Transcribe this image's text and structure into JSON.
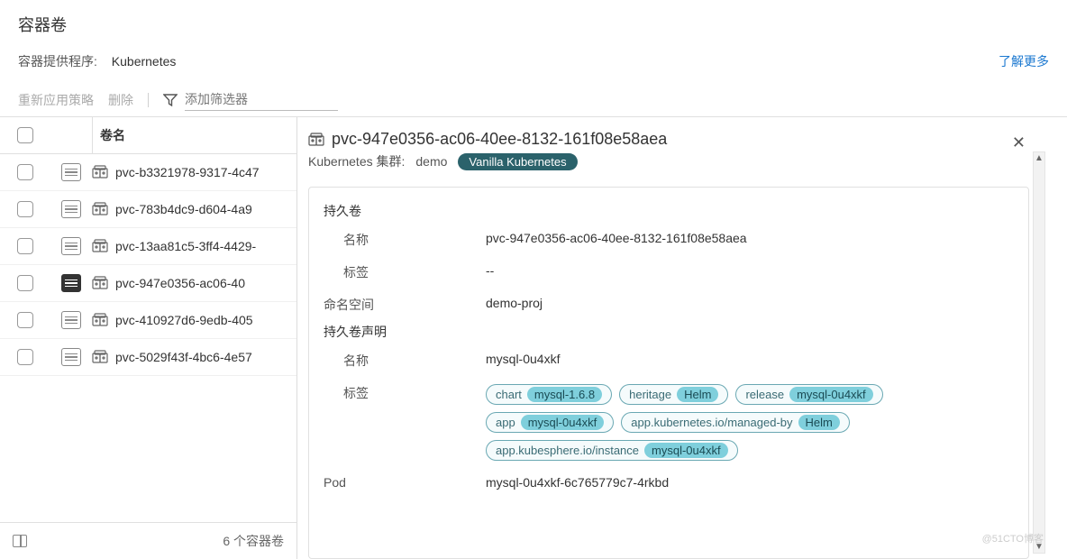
{
  "page_title": "容器卷",
  "provider_label": "容器提供程序:",
  "provider_value": "Kubernetes",
  "learn_more": "了解更多",
  "toolbar": {
    "reapply_policy": "重新应用策略",
    "delete": "删除",
    "filter_placeholder": "添加筛选器"
  },
  "table": {
    "header_name": "卷名",
    "rows": [
      {
        "name": "pvc-b3321978-9317-4c47",
        "selected": false
      },
      {
        "name": "pvc-783b4dc9-d604-4a9",
        "selected": false
      },
      {
        "name": "pvc-13aa81c5-3ff4-4429-",
        "selected": false
      },
      {
        "name": "pvc-947e0356-ac06-40",
        "selected": true
      },
      {
        "name": "pvc-410927d6-9edb-405",
        "selected": false
      },
      {
        "name": "pvc-5029f43f-4bc6-4e57",
        "selected": false
      }
    ],
    "footer_count": "6 个容器卷"
  },
  "detail": {
    "title": "pvc-947e0356-ac06-40ee-8132-161f08e58aea",
    "cluster_label": "Kubernetes 集群:",
    "cluster_value": "demo",
    "cluster_badge": "Vanilla Kubernetes",
    "sections": {
      "pv": {
        "title": "持久卷",
        "name_label": "名称",
        "name_value": "pvc-947e0356-ac06-40ee-8132-161f08e58aea",
        "tag_label": "标签",
        "tag_value": "--"
      },
      "namespace": {
        "label": "命名空间",
        "value": "demo-proj"
      },
      "pvc": {
        "title": "持久卷声明",
        "name_label": "名称",
        "name_value": "mysql-0u4xkf",
        "tag_label": "标签",
        "tags": [
          {
            "key": "chart",
            "value": "mysql-1.6.8"
          },
          {
            "key": "heritage",
            "value": "Helm"
          },
          {
            "key": "release",
            "value": "mysql-0u4xkf"
          },
          {
            "key": "app",
            "value": "mysql-0u4xkf"
          },
          {
            "key": "app.kubernetes.io/managed-by",
            "value": "Helm"
          },
          {
            "key": "app.kubesphere.io/instance",
            "value": "mysql-0u4xkf"
          }
        ]
      },
      "pod": {
        "label": "Pod",
        "value": "mysql-0u4xkf-6c765779c7-4rkbd"
      }
    }
  },
  "watermark": "@51CTO博客"
}
